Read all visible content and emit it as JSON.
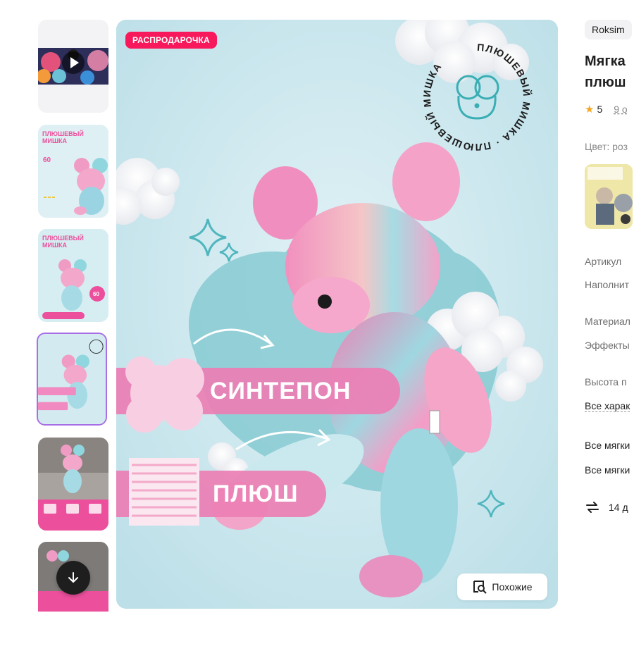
{
  "gallery": {
    "thumbnails": [
      {
        "kind": "video",
        "icon": "play-icon"
      },
      {
        "kind": "image",
        "title": "ПЛЮШЕВЫЙ МИШКА",
        "price": "60"
      },
      {
        "kind": "image",
        "title": "ПЛЮШЕВЫЙ МИШКА",
        "price": "60"
      },
      {
        "kind": "image",
        "selected": true
      },
      {
        "kind": "image"
      },
      {
        "kind": "image"
      }
    ],
    "scroll_down_icon": "arrow-down-icon"
  },
  "main_image": {
    "sale_badge": "РАСПРОДАРОЧКА",
    "stamp_text": "ПЛЮШЕВЫЙ МИШКА · ПЛЮШЕВЫЙ МИШКА",
    "band_1": "СИНТЕПОН",
    "band_2": "ПЛЮШ",
    "similar_button": "Похожие",
    "similar_icon": "search-similar-icon"
  },
  "product": {
    "brand": "Roksim",
    "title_line1": "Мягка",
    "title_line2": "плюш",
    "rating": "5",
    "reviews": "9 о",
    "color_label": "Цвет: роз",
    "attributes": [
      {
        "label": "Артикул"
      },
      {
        "label": "Наполнит"
      },
      {
        "label": "Материал"
      },
      {
        "label": "Эффекты"
      },
      {
        "label": "Высота п"
      },
      {
        "label": "Все харак"
      },
      {
        "label": "Все мягки"
      },
      {
        "label": "Все мягки"
      }
    ],
    "return_text": "14 д"
  },
  "colors": {
    "sale": "#f7195b",
    "accent_pink": "#ec4f9c",
    "background_blue": "#cfe8ef",
    "selected_border": "#a86ee6",
    "star": "#f5a623"
  }
}
